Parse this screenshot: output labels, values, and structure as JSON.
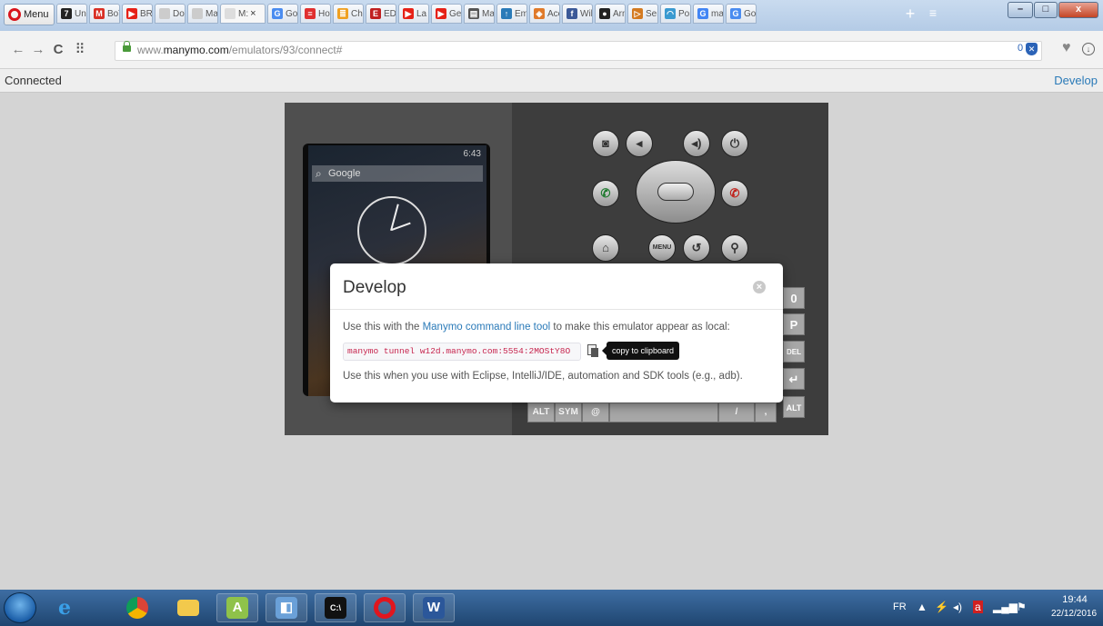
{
  "browser": {
    "menu_label": "Menu",
    "tabs": [
      {
        "label": "Une",
        "icon": "seven-icon",
        "color": "#222222",
        "glyph": "7"
      },
      {
        "label": "Boî",
        "icon": "gmail-icon",
        "color": "#d93025",
        "glyph": "M"
      },
      {
        "label": "BRI",
        "icon": "youtube-icon",
        "color": "#e62117",
        "glyph": "▶"
      },
      {
        "label": "Doc",
        "icon": "blank-page-icon",
        "color": "#cccccc",
        "glyph": ""
      },
      {
        "label": "Ma",
        "icon": "blank-page-icon",
        "color": "#cccccc",
        "glyph": ""
      },
      {
        "label": "M:",
        "icon": "blank-page-icon",
        "color": "#dddddd",
        "glyph": ""
      },
      {
        "label": "Goc",
        "icon": "google-translate-icon",
        "color": "#4a8cf0",
        "glyph": "G"
      },
      {
        "label": "Hov",
        "icon": "stripe-icon",
        "color": "#e03030",
        "glyph": "≡"
      },
      {
        "label": "Cha",
        "icon": "stack-icon",
        "color": "#f0a020",
        "glyph": "≣"
      },
      {
        "label": "EDE",
        "icon": "ede-icon",
        "color": "#c02020",
        "glyph": "E"
      },
      {
        "label": "La v",
        "icon": "youtube-icon",
        "color": "#e62117",
        "glyph": "▶"
      },
      {
        "label": "Get",
        "icon": "youtube-icon",
        "color": "#e62117",
        "glyph": "▶"
      },
      {
        "label": "Ma",
        "icon": "document-icon",
        "color": "#555555",
        "glyph": "▤"
      },
      {
        "label": "Emj",
        "icon": "pin-icon",
        "color": "#2a7ab8",
        "glyph": "↑"
      },
      {
        "label": "Acc",
        "icon": "box-icon",
        "color": "#e07a2a",
        "glyph": "◈"
      },
      {
        "label": "Wil",
        "icon": "facebook-icon",
        "color": "#3b5998",
        "glyph": "f"
      },
      {
        "label": "Arn",
        "icon": "github-icon",
        "color": "#222222",
        "glyph": "●"
      },
      {
        "label": "Ser",
        "icon": "deviantart-icon",
        "color": "#d47a20",
        "glyph": "▷"
      },
      {
        "label": "Por",
        "icon": "rainbow-icon",
        "color": "#3a9ad0",
        "glyph": "◠"
      },
      {
        "label": "ma",
        "icon": "google-icon",
        "color": "#4285f4",
        "glyph": "G"
      },
      {
        "label": "Go",
        "icon": "google-translate-icon",
        "color": "#4a8cf0",
        "glyph": "G"
      }
    ],
    "active_tab_close": "×",
    "url_prefix": "www.",
    "url_domain": "manymo.com",
    "url_path": "/emulators/93/connect#",
    "block_count": "0"
  },
  "page": {
    "status": "Connected",
    "develop_link": "Develop"
  },
  "emulator": {
    "time": "6:43",
    "search_hint": "Google",
    "buttons": [
      "camera-icon",
      "volume-down-icon",
      "volume-up-icon",
      "power-icon",
      "call-icon",
      "end-call-icon",
      "home-icon",
      "menu-button",
      "back-icon",
      "search-icon"
    ],
    "menu_label": "MENU",
    "keys_right": [
      "0",
      "P",
      "DEL",
      "↵",
      "ALT"
    ],
    "bottom_keys": [
      "ALT",
      "SYM",
      "@",
      "",
      "/",
      ","
    ]
  },
  "dialog": {
    "title": "Develop",
    "line1_prefix": "Use this with the ",
    "line1_link": "Manymo command line tool",
    "line1_suffix": " to make this emulator appear as local:",
    "command": "manymo tunnel w12d.manymo.com:5554:2MOStY8O",
    "tooltip": "copy to clipboard",
    "line2": "Use this when you use with Eclipse, IntelliJ/IDE, automation and SDK tools (e.g., adb)."
  },
  "taskbar": {
    "language": "FR",
    "time": "19:44",
    "date": "22/12/2016"
  }
}
